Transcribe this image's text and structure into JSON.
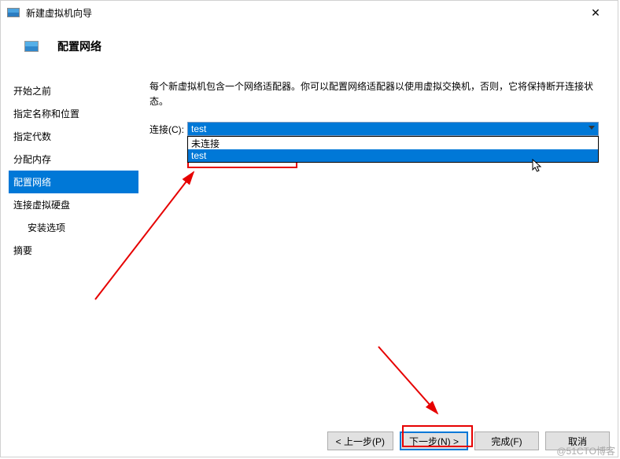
{
  "window": {
    "title": "新建虚拟机向导",
    "close_icon": "✕"
  },
  "header": {
    "title": "配置网络"
  },
  "sidebar": {
    "items": [
      {
        "label": "开始之前"
      },
      {
        "label": "指定名称和位置"
      },
      {
        "label": "指定代数"
      },
      {
        "label": "分配内存"
      },
      {
        "label": "配置网络",
        "selected": true
      },
      {
        "label": "连接虚拟硬盘"
      },
      {
        "label": "安装选项",
        "indent": true
      },
      {
        "label": "摘要"
      }
    ]
  },
  "main": {
    "description": "每个新虚拟机包含一个网络适配器。你可以配置网络适配器以使用虚拟交换机，否则，它将保持断开连接状态。",
    "connection_label": "连接(C):",
    "selected_value": "test",
    "dropdown_options": [
      {
        "label": "未连接"
      },
      {
        "label": "test",
        "highlight": true
      }
    ]
  },
  "footer": {
    "prev": "< 上一步(P)",
    "next": "下一步(N) >",
    "finish": "完成(F)",
    "cancel": "取消"
  },
  "watermark": "@51CTO博客",
  "colors": {
    "selection": "#0078d7",
    "annotation": "#e60000"
  }
}
